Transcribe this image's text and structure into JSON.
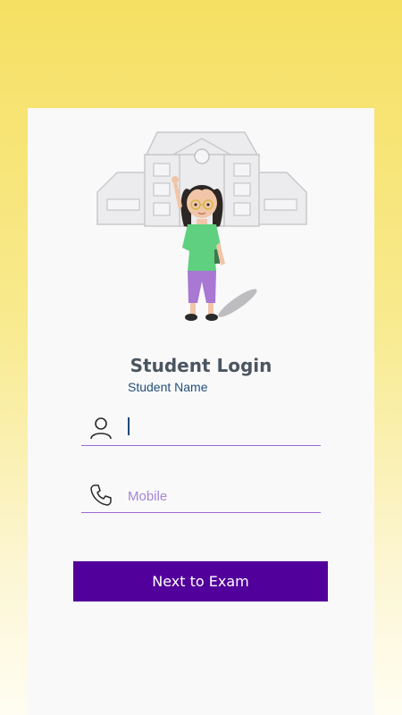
{
  "login": {
    "title": "Student Login",
    "name_label": "Student Name",
    "name_value": "",
    "mobile_placeholder": "Mobile",
    "submit_label": "Next to Exam"
  },
  "icons": {
    "name_field": "person-icon",
    "mobile_field": "phone-icon"
  },
  "colors": {
    "background_top": "#f6e063",
    "card": "#f9f9fa",
    "title": "#4a5560",
    "label": "#234f7a",
    "underline": "#9c6ad3",
    "placeholder": "#a586d6",
    "button": "#52009b",
    "button_text": "#ffffff"
  }
}
